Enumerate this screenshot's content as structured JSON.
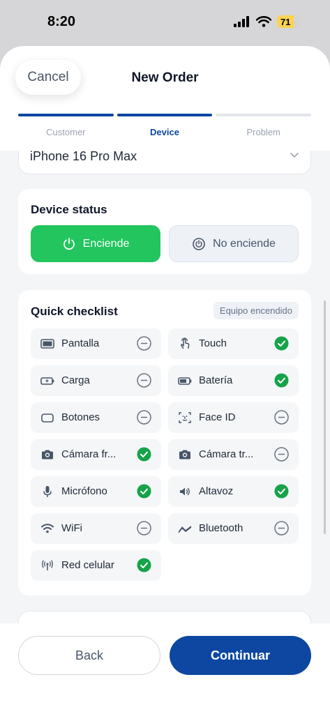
{
  "status_bar": {
    "time": "8:20",
    "battery": "71",
    "battery_level": 0.71
  },
  "header": {
    "cancel_label": "Cancel",
    "title": "New Order"
  },
  "steps": [
    {
      "label": "Customer",
      "state": "done"
    },
    {
      "label": "Device",
      "state": "active"
    },
    {
      "label": "Problem",
      "state": "pending"
    }
  ],
  "device": {
    "selected": "iPhone 16 Pro Max"
  },
  "device_status": {
    "title": "Device status",
    "on_label": "Enciende",
    "off_label": "No enciende",
    "selected": "on"
  },
  "checklist": {
    "title": "Quick checklist",
    "tag": "Equipo encendido",
    "items": [
      {
        "label": "Pantalla",
        "icon": "screen-icon",
        "checked": false
      },
      {
        "label": "Touch",
        "icon": "touch-icon",
        "checked": true
      },
      {
        "label": "Carga",
        "icon": "charging-icon",
        "checked": false
      },
      {
        "label": "Batería",
        "icon": "battery-icon",
        "checked": true
      },
      {
        "label": "Botones",
        "icon": "buttons-icon",
        "checked": false
      },
      {
        "label": "Face ID",
        "icon": "face-id-icon",
        "checked": false
      },
      {
        "label": "Cámara fr...",
        "icon": "camera-icon",
        "checked": true
      },
      {
        "label": "Cámara tr...",
        "icon": "camera-icon",
        "checked": false
      },
      {
        "label": "Micrófono",
        "icon": "microphone-icon",
        "checked": true
      },
      {
        "label": "Altavoz",
        "icon": "speaker-icon",
        "checked": true
      },
      {
        "label": "WiFi",
        "icon": "wifi-icon",
        "checked": false
      },
      {
        "label": "Bluetooth",
        "icon": "bluetooth-icon",
        "checked": false
      },
      {
        "label": "Red celular",
        "icon": "cellular-icon",
        "checked": true
      }
    ]
  },
  "footer": {
    "back_label": "Back",
    "continue_label": "Continuar"
  },
  "colors": {
    "primary": "#0d47a1",
    "success": "#22c55e",
    "check": "#16a34a"
  }
}
